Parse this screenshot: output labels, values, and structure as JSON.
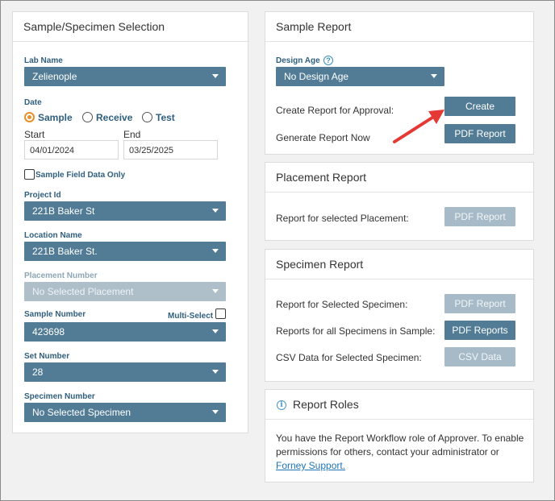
{
  "left": {
    "title": "Sample/Specimen Selection",
    "lab_name_label": "Lab Name",
    "lab_name_value": "Zelienople",
    "date_label": "Date",
    "date_options": [
      "Sample",
      "Receive",
      "Test"
    ],
    "date_selected": "Sample",
    "start_label": "Start",
    "start_value": "04/01/2024",
    "end_label": "End",
    "end_value": "03/25/2025",
    "field_data_only_label": "Sample Field Data Only",
    "project_id_label": "Project Id",
    "project_id_value": "221B Baker St",
    "location_name_label": "Location Name",
    "location_name_value": "221B Baker St.",
    "placement_number_label": "Placement Number",
    "placement_number_value": "No Selected Placement",
    "sample_number_label": "Sample Number",
    "multi_select_label": "Multi-Select",
    "sample_number_value": "423698",
    "set_number_label": "Set Number",
    "set_number_value": "28",
    "specimen_number_label": "Specimen Number",
    "specimen_number_value": "No Selected Specimen"
  },
  "sample_report": {
    "title": "Sample Report",
    "design_age_label": "Design Age",
    "design_age_value": "No Design Age",
    "create_label": "Create Report for Approval:",
    "create_button": "Create",
    "generate_label": "Generate Report Now",
    "pdf_button": "PDF Report"
  },
  "placement_report": {
    "title": "Placement Report",
    "row_label": "Report for selected Placement:",
    "pdf_button": "PDF Report"
  },
  "specimen_report": {
    "title": "Specimen Report",
    "selected_label": "Report for Selected Specimen:",
    "selected_button": "PDF Report",
    "all_label": "Reports for all Specimens in Sample:",
    "all_button": "PDF Reports",
    "csv_label": "CSV Data for Selected Specimen:",
    "csv_button": "CSV Data"
  },
  "report_roles": {
    "title": "Report Roles",
    "text_line1": "You have the Report Workflow role of Approver. To enable",
    "text_line2": "permissions for others, contact your administrator or",
    "link": "Forney Support."
  },
  "colors": {
    "accent": "#527c95",
    "radio_selected": "#e6902a",
    "label": "#2f5f7f",
    "annotation_arrow": "#e53935"
  },
  "icons": [
    "caret-down-icon",
    "help-icon",
    "info-icon",
    "red-arrow-annotation"
  ]
}
